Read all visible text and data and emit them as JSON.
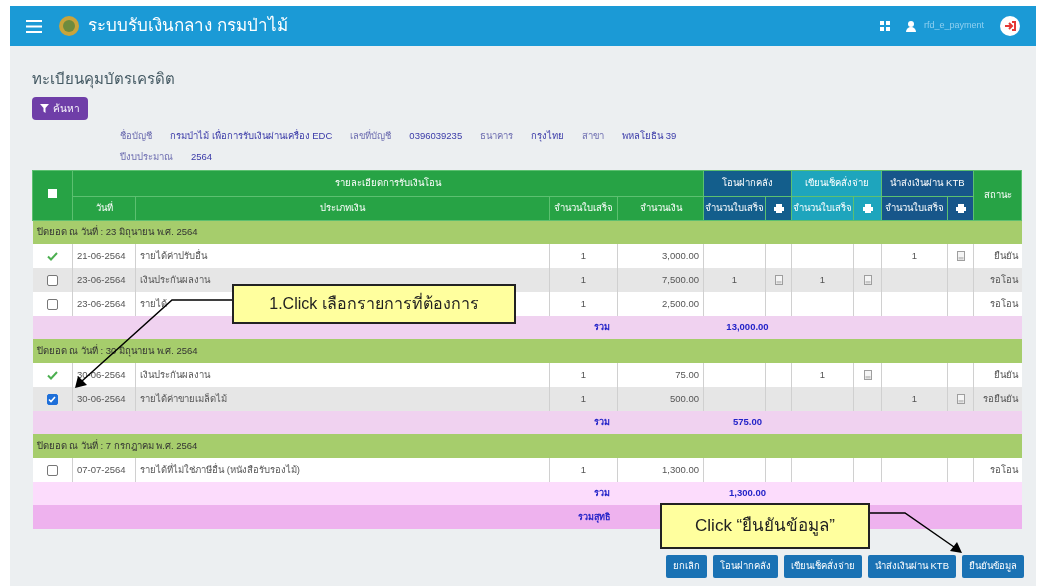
{
  "header": {
    "title": "ระบบรับเงินกลาง กรมป่าไม้",
    "username": "rfd_e_payment"
  },
  "page_title": "ทะเบียนคุมบัตรเครดิต",
  "search_button": "ค้นหา",
  "account": [
    {
      "label": "ชื่อบัญชี",
      "value": "กรมป่าไม้ เพื่อการรับเงินผ่านเครื่อง EDC"
    },
    {
      "label": "เลขที่บัญชี",
      "value": "0396039235"
    },
    {
      "label": "ธนาคาร",
      "value": "กรุงไทย"
    },
    {
      "label": "สาขา",
      "value": "พหลโยธิน 39"
    }
  ],
  "fiscal_year": {
    "label": "ปีงบประมาณ",
    "value": "2564"
  },
  "table": {
    "select_all_checked": false,
    "detail_header": "รายละเอียดการรับเงินโอน",
    "columns": [
      "วันที่",
      "ประเภทเงิน",
      "จำนวนใบเสร็จ",
      "จำนวนเงิน"
    ],
    "channels": [
      {
        "title": "โอนฝากคลัง",
        "count_header": "จำนวนใบเสร็จ"
      },
      {
        "title": "เขียนเช็คสั่งจ่าย",
        "count_header": "จำนวนใบเสร็จ"
      },
      {
        "title": "นำส่งเงินผ่าน KTB",
        "count_header": "จำนวนใบเสร็จ"
      }
    ],
    "status_header": "สถานะ",
    "groups": [
      {
        "title": "ปิดยอด ณ วันที่ : 23 มิถุนายน พ.ศ. 2564",
        "subtotal_label": "รวม",
        "subtotal": "13,000.00",
        "rows": [
          {
            "kind": "done",
            "date": "21-06-2564",
            "type": "รายได้ค่าปรับอื่น",
            "count": "1",
            "amount": "3,000.00",
            "ktb_count": "1",
            "status": "ยืนยัน"
          },
          {
            "kind": "checkbox",
            "checked": false,
            "date": "23-06-2564",
            "type": "เงินประกันผลงาน",
            "count": "1",
            "amount": "7,500.00",
            "transfer_count": "1",
            "cheque_count": "1",
            "status": "รอโอน"
          },
          {
            "kind": "checkbox",
            "checked": false,
            "date": "23-06-2564",
            "type": "รายได้",
            "count": "1",
            "amount": "2,500.00",
            "status": "รอโอน"
          }
        ]
      },
      {
        "title": "ปิดยอด ณ วันที่ : 30 มิถุนายน พ.ศ. 2564",
        "subtotal_label": "รวม",
        "subtotal": "575.00",
        "rows": [
          {
            "kind": "done",
            "date": "30-06-2564",
            "type": "เงินประกันผลงาน",
            "count": "1",
            "amount": "75.00",
            "cheque_count": "1",
            "status": "ยืนยัน"
          },
          {
            "kind": "checkbox",
            "checked": true,
            "date": "30-06-2564",
            "type": "รายได้ค่าขายเมล็ดไม้",
            "count": "1",
            "amount": "500.00",
            "ktb_count": "1",
            "status": "รอยืนยัน"
          }
        ]
      },
      {
        "title": "ปิดยอด ณ วันที่ : 7 กรกฎาคม พ.ศ. 2564",
        "subtotal_label": "รวม",
        "subtotal": "1,300.00",
        "rows": [
          {
            "kind": "checkbox",
            "checked": false,
            "date": "07-07-2564",
            "type": "รายได้ที่ไม่ใช่ภาษีอื่น (หนังสือรับรองไม้)",
            "count": "1",
            "amount": "1,300.00",
            "status": "รอโอน"
          }
        ]
      }
    ],
    "grand_total_label": "รวมสุทธิ"
  },
  "buttons": [
    "ยกเลิก",
    "โอนฝากคลัง",
    "เขียนเช็คสั่งจ่าย",
    "นำส่งเงินผ่าน KTB",
    "ยืนยันข้อมูล"
  ],
  "callouts": [
    {
      "text": "1.Click เลือกรายการที่ต้องการ"
    },
    {
      "text": "Click “ยืนยันข้อมูล”"
    }
  ]
}
